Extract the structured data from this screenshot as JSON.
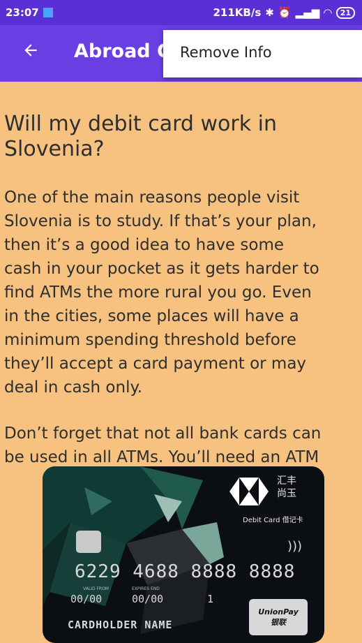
{
  "status_bar": {
    "time": "23:07",
    "network_speed": "211KB/s",
    "battery": "21"
  },
  "app_bar": {
    "title": "Abroad G",
    "back_icon": "arrow-left-icon"
  },
  "menu": {
    "items": [
      {
        "label": "Remove Info"
      }
    ]
  },
  "article": {
    "heading_line1": "Will my debit card work in",
    "heading_line2": "Slovenia?",
    "paragraph1_lines": [
      "One of the main reasons people visit",
      "Slovenia is to study. If that’s your plan,",
      "then it’s a good idea to have some",
      "cash in your pocket as it gets harder to",
      "find ATMs the more rural you go. Even",
      "in the cities, some places will have a",
      "minimum spending threshold before",
      "they’ll accept a card payment or may",
      "deal in cash only."
    ],
    "paragraph2_line1": "Don’t forget that not all bank cards can",
    "paragraph2_line2": "be used in all ATMs. You’ll need an ATM"
  },
  "card": {
    "bank_chars": "汇丰\n尚玉",
    "debit_label": "Debit Card 借记卡",
    "number": "6229 4688 8888 8888",
    "valid_from_label": "VALID FROM",
    "expires_end_label": "EXPIRES END",
    "valid_from": "00/00",
    "expires_end": "00/00",
    "sequence": "1",
    "holder": "CARDHOLDER NAME",
    "network_line1": "UnionPay",
    "network_line2": "银联"
  },
  "colors": {
    "status_bar": "#5a2fd6",
    "app_bar": "#6a3ee3",
    "background": "#f7c27f",
    "text": "#2e2e2e"
  }
}
